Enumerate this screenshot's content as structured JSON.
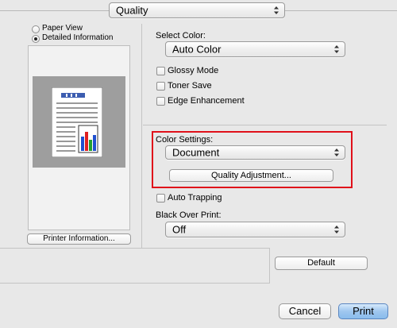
{
  "panel_selector": {
    "value": "Quality"
  },
  "view_mode": {
    "options": [
      {
        "label": "Paper View",
        "selected": false
      },
      {
        "label": "Detailed Information",
        "selected": true
      }
    ]
  },
  "printer_info_button": "Printer Information...",
  "select_color": {
    "label": "Select Color:",
    "value": "Auto Color"
  },
  "checkboxes": {
    "glossy_mode": {
      "label": "Glossy Mode",
      "checked": false
    },
    "toner_save": {
      "label": "Toner Save",
      "checked": false
    },
    "edge_enhancement": {
      "label": "Edge Enhancement",
      "checked": false
    },
    "auto_trapping": {
      "label": "Auto Trapping",
      "checked": false
    }
  },
  "color_settings": {
    "label": "Color Settings:",
    "value": "Document",
    "quality_adjustment_button": "Quality Adjustment..."
  },
  "black_over_print": {
    "label": "Black Over Print:",
    "value": "Off"
  },
  "default_button": "Default",
  "cancel_button": "Cancel",
  "print_button": "Print",
  "colors": {
    "highlight_border": "#e0101a",
    "primary_button": "#8abcec"
  }
}
